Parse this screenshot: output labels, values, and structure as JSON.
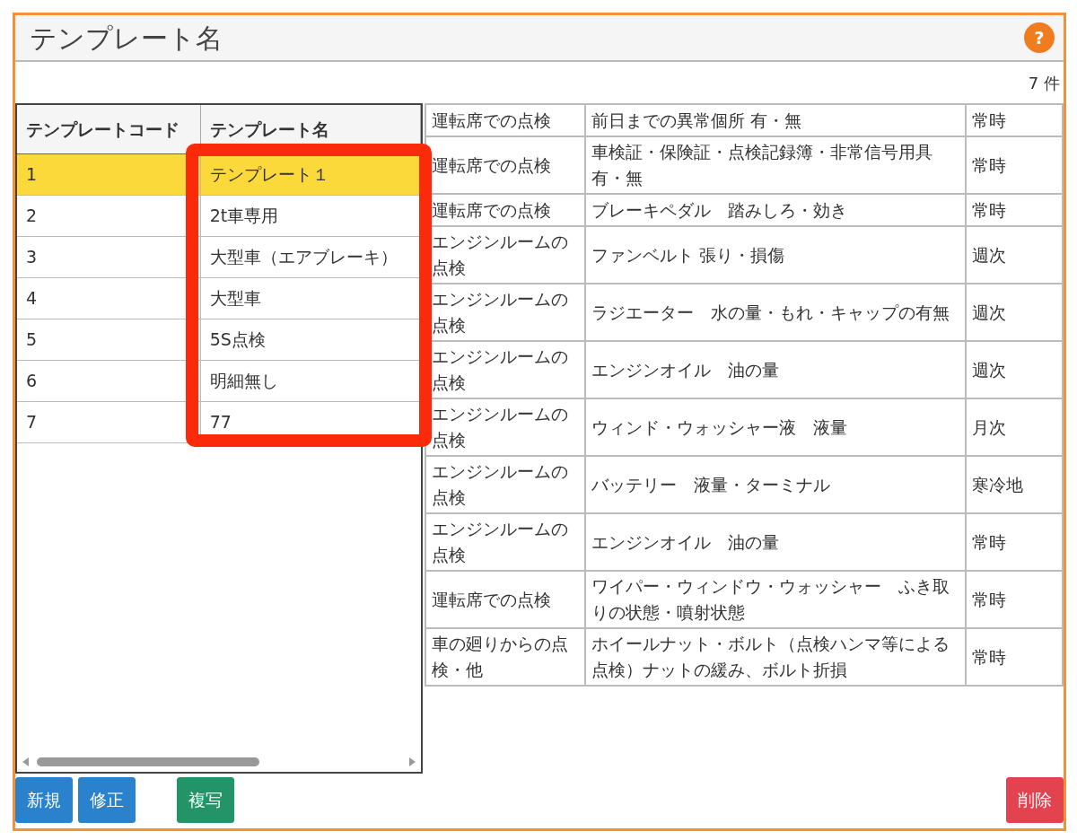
{
  "title": "テンプレート名",
  "help": "?",
  "count": "7 件",
  "templates": {
    "columns": [
      "テンプレートコード",
      "テンプレート名"
    ],
    "rows": [
      {
        "code": "1",
        "name": "テンプレート１",
        "selected": true
      },
      {
        "code": "2",
        "name": "2t車専用",
        "selected": false
      },
      {
        "code": "3",
        "name": "大型車（エアブレーキ）",
        "selected": false
      },
      {
        "code": "4",
        "name": "大型車",
        "selected": false
      },
      {
        "code": "5",
        "name": "5S点検",
        "selected": false
      },
      {
        "code": "6",
        "name": "明細無し",
        "selected": false
      },
      {
        "code": "7",
        "name": "77",
        "selected": false
      }
    ]
  },
  "details": [
    [
      "運転席での点検",
      "前日までの異常個所 有・無",
      "常時"
    ],
    [
      "運転席での点検",
      "車検証・保険証・点検記録簿・非常信号用具有・無",
      "常時"
    ],
    [
      "運転席での点検",
      "ブレーキペダル　踏みしろ・効き",
      "常時"
    ],
    [
      "エンジンルームの点検",
      "ファンベルト 張り・損傷",
      "週次"
    ],
    [
      "エンジンルームの点検",
      "ラジエーター　水の量・もれ・キャップの有無",
      "週次"
    ],
    [
      "エンジンルームの点検",
      "エンジンオイル　油の量",
      "週次"
    ],
    [
      "エンジンルームの点検",
      "ウィンド・ウォッシャー液　液量",
      "月次"
    ],
    [
      "エンジンルームの点検",
      "バッテリー　液量・ターミナル",
      "寒冷地"
    ],
    [
      "エンジンルームの点検",
      "エンジンオイル　油の量",
      "常時"
    ],
    [
      "運転席での点検",
      "ワイパー・ウィンドウ・ウォッシャー　ふき取りの状態・噴射状態",
      "常時"
    ],
    [
      "車の廻りからの点検・他",
      "ホイールナット・ボルト（点検ハンマ等による点検）ナットの緩み、ボルト折損",
      "常時"
    ]
  ],
  "buttons": [
    {
      "label": "新規",
      "kind": "primary"
    },
    {
      "label": "修正",
      "kind": "primary"
    },
    {
      "label": "複写",
      "kind": "success"
    },
    {
      "label": "削除",
      "kind": "danger"
    }
  ]
}
